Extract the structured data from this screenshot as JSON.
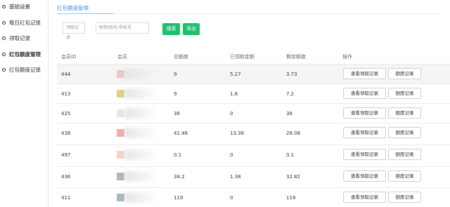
{
  "sidebar": {
    "items": [
      {
        "label": "基础设置",
        "active": false
      },
      {
        "label": "每日红包记录",
        "active": false
      },
      {
        "label": "领取记录",
        "active": false
      },
      {
        "label": "红包额度管理",
        "active": true
      },
      {
        "label": "红包额度记录",
        "active": false
      }
    ]
  },
  "page": {
    "title": "红包额度管理"
  },
  "filters": {
    "record_placeholder": "领取记录",
    "search_placeholder": "昵称/姓名/手机号",
    "search_label": "搜索",
    "export_label": "导出"
  },
  "table": {
    "headers": [
      "会员ID",
      "会员",
      "总额度",
      "已领取金额",
      "剩余额度",
      "操作"
    ],
    "action_view_label": "查看领取记录",
    "action_quota_label": "额度记录",
    "rows": [
      {
        "id": "444",
        "total": "9",
        "received": "5.27",
        "remaining": "3.73",
        "avatar_color": "#e8c9c4"
      },
      {
        "id": "413",
        "total": "9",
        "received": "1.8",
        "remaining": "7.2",
        "avatar_color": "#e2cf86"
      },
      {
        "id": "425",
        "total": "36",
        "received": "0",
        "remaining": "36",
        "avatar_color": "#e6e6e6"
      },
      {
        "id": "438",
        "total": "41.46",
        "received": "13.38",
        "remaining": "28.08",
        "avatar_color": "#f3aca2"
      },
      {
        "id": "497",
        "total": "0.1",
        "received": "0",
        "remaining": "0.1",
        "avatar_color": "#f4d2cb"
      },
      {
        "id": "436",
        "total": "34.2",
        "received": "1.38",
        "remaining": "32.82",
        "avatar_color": "#bcb3b1"
      },
      {
        "id": "411",
        "total": "119",
        "received": "0",
        "remaining": "119",
        "avatar_color": "#a9b7c1"
      }
    ]
  },
  "colors": {
    "accent": "#4a8fd1",
    "button_green": "#1fbf6b"
  }
}
